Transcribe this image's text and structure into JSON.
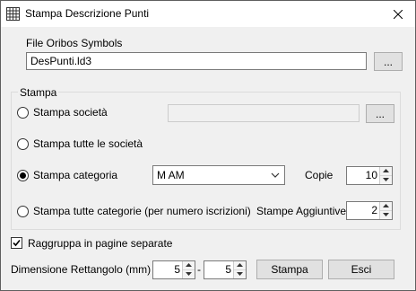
{
  "window": {
    "title": "Stampa Descrizione Punti"
  },
  "file": {
    "label": "File Oribos Symbols",
    "value": "DesPunti.ld3",
    "browse_label": "..."
  },
  "stampa_group": {
    "label": "Stampa",
    "societa": {
      "label": "Stampa società",
      "checked": false,
      "value": "",
      "browse_label": "..."
    },
    "tutte_societa": {
      "label": "Stampa tutte le società",
      "checked": false
    },
    "categoria": {
      "label": "Stampa categoria",
      "checked": true,
      "selected": "M AM"
    },
    "copie": {
      "label": "Copie",
      "value": "10"
    },
    "tutte_categorie": {
      "label": "Stampa tutte categorie (per numero iscrizioni)",
      "checked": false
    },
    "aggiuntive": {
      "label": "Stampe Aggiuntive",
      "value": "2"
    }
  },
  "raggruppa": {
    "label": "Raggruppa in pagine separate",
    "checked": true
  },
  "dimensione": {
    "label": "Dimensione Rettangolo (mm)",
    "width_value": "5",
    "separator": "-",
    "height_value": "5"
  },
  "actions": {
    "print_label": "Stampa",
    "exit_label": "Esci"
  },
  "colors": {
    "window_bg": "#f0f0f0",
    "button_bg": "#e1e1e1",
    "border": "#7a7a7a"
  }
}
